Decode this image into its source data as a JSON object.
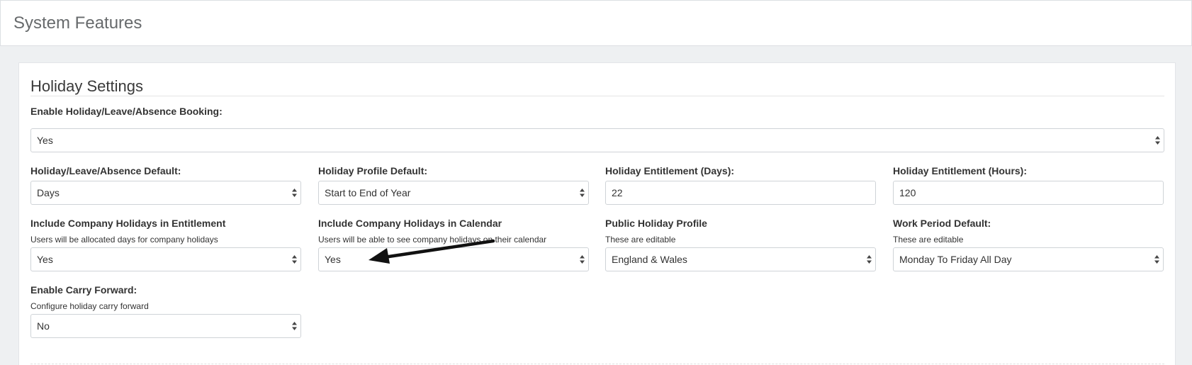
{
  "page": {
    "title": "System Features"
  },
  "section": {
    "title": "Holiday Settings"
  },
  "fields": {
    "enable_booking": {
      "label": "Enable Holiday/Leave/Absence Booking:",
      "value": "Yes"
    },
    "absence_default": {
      "label": "Holiday/Leave/Absence Default:",
      "value": "Days"
    },
    "profile_default": {
      "label": "Holiday Profile Default:",
      "value": "Start to End of Year"
    },
    "entitlement_days": {
      "label": "Holiday Entitlement (Days):",
      "value": "22"
    },
    "entitlement_hours": {
      "label": "Holiday Entitlement (Hours):",
      "value": "120"
    },
    "company_holidays_entitlement": {
      "label": "Include Company Holidays in Entitlement",
      "help": "Users will be allocated days for company holidays",
      "value": "Yes"
    },
    "company_holidays_calendar": {
      "label": "Include Company Holidays in Calendar",
      "help": "Users will be able to see company holidays on their calendar",
      "value": "Yes"
    },
    "public_holiday_profile": {
      "label": "Public Holiday Profile",
      "help": "These are editable",
      "value": "England & Wales"
    },
    "work_period_default": {
      "label": "Work Period Default:",
      "help": "These are editable",
      "value": "Monday To Friday All Day"
    },
    "carry_forward": {
      "label": "Enable Carry Forward:",
      "help": "Configure holiday carry forward",
      "value": "No"
    }
  },
  "annotation": {
    "arrow_color": "#111111"
  },
  "icons": {
    "select_caret": "select-caret-icon"
  }
}
